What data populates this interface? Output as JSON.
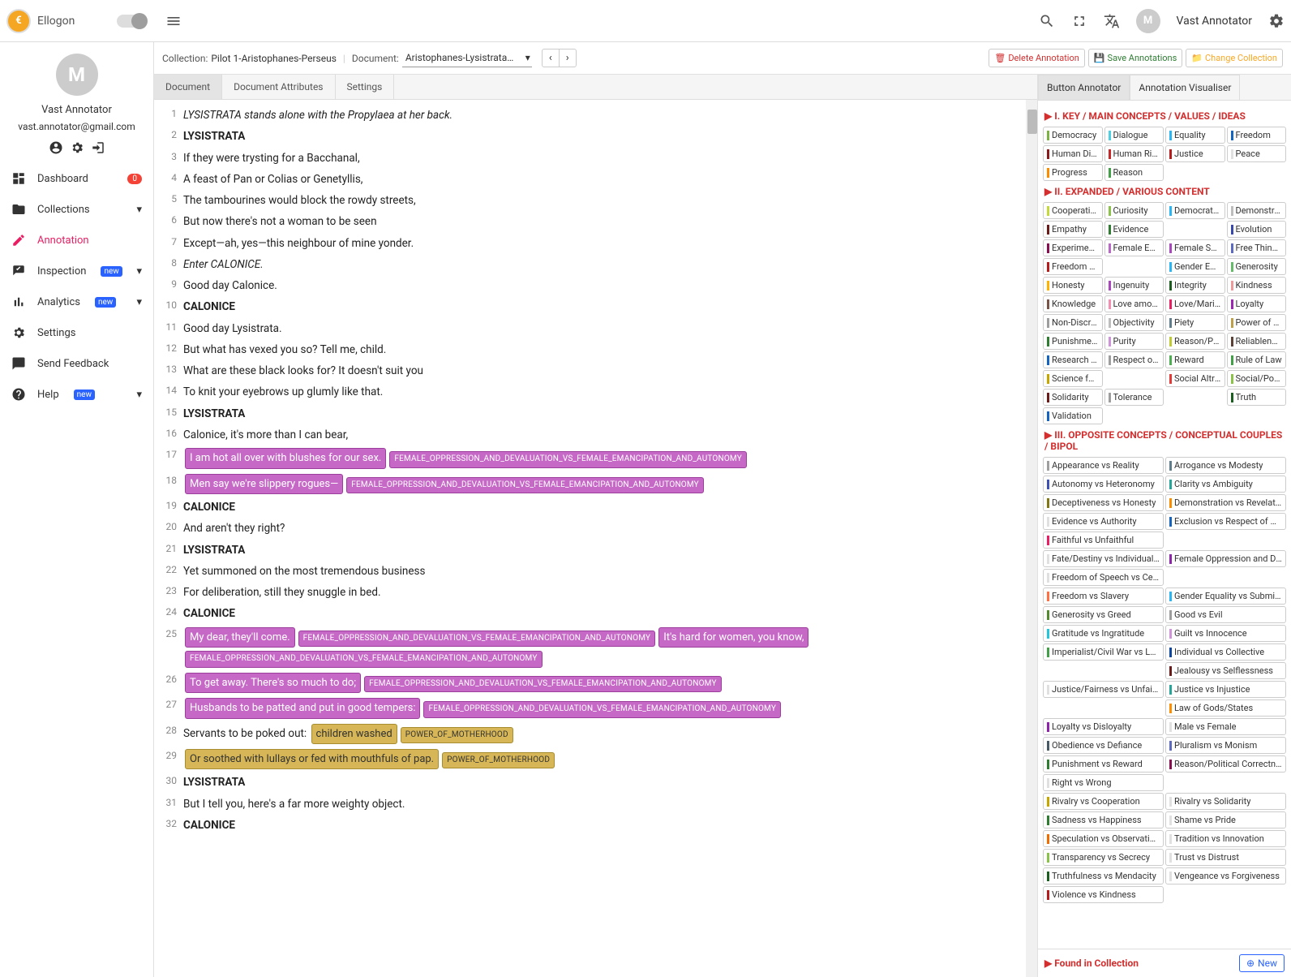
{
  "app": {
    "name": "Ellogon"
  },
  "user": {
    "name": "Vast Annotator",
    "email": "vast.annotator@gmail.com",
    "initial": "M"
  },
  "sidebar": {
    "items": [
      {
        "label": "Dashboard",
        "icon": "dashboard",
        "badge0": "0"
      },
      {
        "label": "Collections",
        "icon": "folder",
        "chev": true
      },
      {
        "label": "Annotation",
        "icon": "edit",
        "active": true
      },
      {
        "label": "Inspection",
        "icon": "inspect",
        "new": true,
        "chev": true
      },
      {
        "label": "Analytics",
        "icon": "analytics",
        "new": true,
        "chev": true
      },
      {
        "label": "Settings",
        "icon": "gear"
      },
      {
        "label": "Send Feedback",
        "icon": "feedback"
      },
      {
        "label": "Help",
        "icon": "help",
        "new": true,
        "chev": true
      }
    ],
    "newBadge": "new"
  },
  "breadcrumb": {
    "collectionLabel": "Collection:",
    "collectionValue": "Pilot 1-Aristophanes-Perseus",
    "documentLabel": "Document:",
    "documentValue": "Aristophanes-Lysistrata-Jac..."
  },
  "actions": {
    "delete": "Delete Annotation",
    "save": "Save Annotations",
    "change": "Change Collection"
  },
  "docTabs": [
    "Document",
    "Document Attributes",
    "Settings"
  ],
  "rpTabs": [
    "Button Annotator",
    "Annotation Visualiser"
  ],
  "lines": [
    {
      "n": 1,
      "t": "LYSISTRATA stands alone with the Propylaea at her back.",
      "cls": "italic"
    },
    {
      "n": 2,
      "t": "LYSISTRATA",
      "cls": "bold"
    },
    {
      "n": 3,
      "t": "If they were trysting for a Bacchanal,"
    },
    {
      "n": 4,
      "t": "A feast of Pan or Colias or Genetyllis,"
    },
    {
      "n": 5,
      "t": "The tambourines would block the rowdy streets,"
    },
    {
      "n": 6,
      "t": "But now there's not a woman to be seen"
    },
    {
      "n": 7,
      "t": "Except—ah, yes—this neighbour of mine yonder."
    },
    {
      "n": 8,
      "t": "Enter CALONICE.",
      "cls": "italic"
    },
    {
      "n": 9,
      "t": "Good day Calonice."
    },
    {
      "n": 10,
      "t": "CALONICE",
      "cls": "bold"
    },
    {
      "n": 11,
      "t": "Good day Lysistrata."
    },
    {
      "n": 12,
      "t": "But what has vexed you so? Tell me, child."
    },
    {
      "n": 13,
      "t": "What are these black looks for? It doesn't suit you"
    },
    {
      "n": 14,
      "t": "To knit your eyebrows up glumly like that."
    },
    {
      "n": 15,
      "t": "LYSISTRATA",
      "cls": "bold"
    },
    {
      "n": 16,
      "t": "Calonice, it's more than I can bear,"
    },
    {
      "n": 17,
      "hl": [
        {
          "t": "I am hot all over with blushes for our sex.",
          "c": "purple"
        },
        {
          "t": "FEMALE_OPPRESSION_AND_DEVALUATION_VS_FEMALE_EMANCIPATION_AND_AUTONOMY",
          "c": "purple",
          "mini": true
        }
      ]
    },
    {
      "n": 18,
      "hl": [
        {
          "t": "Men say we're slippery rogues—",
          "c": "purple"
        },
        {
          "t": "FEMALE_OPPRESSION_AND_DEVALUATION_VS_FEMALE_EMANCIPATION_AND_AUTONOMY",
          "c": "purple",
          "mini": true
        }
      ]
    },
    {
      "n": 19,
      "t": "CALONICE",
      "cls": "bold"
    },
    {
      "n": 20,
      "t": "And aren't they right?"
    },
    {
      "n": 21,
      "t": "LYSISTRATA",
      "cls": "bold"
    },
    {
      "n": 22,
      "t": "Yet summoned on the most tremendous business"
    },
    {
      "n": 23,
      "t": "For deliberation, still they snuggle in bed."
    },
    {
      "n": 24,
      "t": "CALONICE",
      "cls": "bold"
    },
    {
      "n": 25,
      "hl": [
        {
          "t": "My dear, they'll come.",
          "c": "purple"
        },
        {
          "t": "FEMALE_OPPRESSION_AND_DEVALUATION_VS_FEMALE_EMANCIPATION_AND_AUTONOMY",
          "c": "purple",
          "mini": true
        },
        {
          "t": "It's hard for women, you know,",
          "c": "purple"
        },
        {
          "t": "FEMALE_OPPRESSION_AND_DEVALUATION_VS_FEMALE_EMANCIPATION_AND_AUTONOMY",
          "c": "purple",
          "mini": true,
          "wrap": true
        }
      ]
    },
    {
      "n": 26,
      "hl": [
        {
          "t": "To get away. There's so much to do;",
          "c": "purple"
        },
        {
          "t": "FEMALE_OPPRESSION_AND_DEVALUATION_VS_FEMALE_EMANCIPATION_AND_AUTONOMY",
          "c": "purple",
          "mini": true
        }
      ]
    },
    {
      "n": 27,
      "hl": [
        {
          "t": "Husbands to be patted and put in good tempers:",
          "c": "purple"
        },
        {
          "t": "FEMALE_OPPRESSION_AND_DEVALUATION_VS_FEMALE_EMANCIPATION_AND_AUTONOMY",
          "c": "purple",
          "mini": true
        }
      ]
    },
    {
      "n": 28,
      "pre": "Servants to be poked out: ",
      "hl": [
        {
          "t": "children washed",
          "c": "ochre"
        },
        {
          "t": "POWER_OF_MOTHERHOOD",
          "c": "ochre",
          "mini": true
        }
      ]
    },
    {
      "n": 29,
      "hl": [
        {
          "t": "Or soothed with lullays or fed with mouthfuls of pap.",
          "c": "ochre"
        },
        {
          "t": "POWER_OF_MOTHERHOOD",
          "c": "ochre",
          "mini": true
        }
      ]
    },
    {
      "n": 30,
      "t": "LYSISTRATA",
      "cls": "bold"
    },
    {
      "n": 31,
      "t": "But I tell you, here's a far more weighty object."
    },
    {
      "n": 32,
      "t": "CALONICE",
      "cls": "bold"
    }
  ],
  "sections": {
    "s1": {
      "title": "I. KEY / MAIN CONCEPTS / VALUES / IDEAS",
      "tags": [
        {
          "l": "Democracy",
          "c": "#7cb342"
        },
        {
          "l": "Dialogue",
          "c": "#4dd0e1"
        },
        {
          "l": "Equality",
          "c": "#29b6f6"
        },
        {
          "l": "Freedom",
          "c": "#1565c0"
        },
        {
          "l": "Human Dignity",
          "c": "#8b1a1a"
        },
        {
          "l": "Human Rights",
          "c": "#c62828"
        },
        {
          "l": "Justice",
          "c": "#b71c1c"
        },
        {
          "l": "Peace",
          "c": "#e0e0e0"
        },
        {
          "l": "Progress",
          "c": "#fb8c00"
        },
        {
          "l": "Reason",
          "c": "#43a047"
        }
      ]
    },
    "s2": {
      "title": "II. EXPANDED / VARIOUS CONTENT",
      "tags": [
        {
          "l": "Cooperation",
          "c": "#c6d93b"
        },
        {
          "l": "Curiosity",
          "c": "#8bc34a"
        },
        {
          "l": "Democratic ... and Equality",
          "c": "#29b6f6"
        },
        {
          "l": "Demonstrab...",
          "c": "#bdbdbd"
        },
        {
          "l": "Empathy",
          "c": "#6a1b1a"
        },
        {
          "l": "Evidence",
          "c": "#2e7d32"
        },
        {
          "l": "",
          "c": "#fff",
          "skip": true
        },
        {
          "l": "Evolution",
          "c": "#3949ab"
        },
        {
          "l": "Experimenta...",
          "c": "#880e4f"
        },
        {
          "l": "Female Em... and Autonomy",
          "c": "#ba68c8"
        },
        {
          "l": "Female Spe...",
          "c": "#ab47bc"
        },
        {
          "l": "Free Thinking",
          "c": "#5c6bc0"
        },
        {
          "l": "Freedom of ...",
          "c": "#b71c1c"
        },
        {
          "l": "",
          "c": "#fff",
          "skip": true
        },
        {
          "l": "Gender Equ...",
          "c": "#29b6f6"
        },
        {
          "l": "Generosity",
          "c": "#66bb6a"
        },
        {
          "l": "Honesty",
          "c": "#ffb300"
        },
        {
          "l": "Ingenuity",
          "c": "#ab47bc"
        },
        {
          "l": "Integrity",
          "c": "#1b5e20"
        },
        {
          "l": "Kindness",
          "c": "#ef9a9a"
        },
        {
          "l": "Knowledge",
          "c": "#795548"
        },
        {
          "l": "Love among...",
          "c": "#f48fb1"
        },
        {
          "l": "Love/Marital ...",
          "c": "#e91e63"
        },
        {
          "l": "Loyalty",
          "c": "#9c27b0"
        },
        {
          "l": "Non-Discrim...",
          "c": "#9e9e9e"
        },
        {
          "l": "Objectivity",
          "c": "#bdbdbd"
        },
        {
          "l": "Piety",
          "c": "#607d8b"
        },
        {
          "l": "Power of Mot...",
          "c": "#bfa04a"
        },
        {
          "l": "Punishment",
          "c": "#2e7d32"
        },
        {
          "l": "Purity",
          "c": "#ce93d8"
        },
        {
          "l": "Reason/Poli...",
          "c": "#c0ca33"
        },
        {
          "l": "Reliableness",
          "c": "#5d4037"
        },
        {
          "l": "Research Fr...",
          "c": "#1565c0"
        },
        {
          "l": "Respect of ... Decisions",
          "c": "#9e9e9e"
        },
        {
          "l": "Reward",
          "c": "#4caf50"
        },
        {
          "l": "Rule of Law",
          "c": "#43a047"
        },
        {
          "l": "Science for ...",
          "c": "#c6a700"
        },
        {
          "l": "",
          "c": "#fff",
          "skip": true
        },
        {
          "l": "Social Altrui... Self-sacrifice",
          "c": "#e53935"
        },
        {
          "l": "Social/Politic...",
          "c": "#8bc34a"
        },
        {
          "l": "Solidarity",
          "c": "#6a1b1a"
        },
        {
          "l": "Tolerance",
          "c": "#9e9e9e"
        },
        {
          "l": "",
          "c": "#fff",
          "skip": true
        },
        {
          "l": "Truth",
          "c": "#1b5e20"
        },
        {
          "l": "Validation",
          "c": "#1565c0"
        }
      ]
    },
    "s3": {
      "title": "III. OPPOSITE CONCEPTS / CONCEPTUAL COUPLES / BIPOL",
      "tags": [
        {
          "l": "Appearance vs Reality",
          "c": "#9e9e9e"
        },
        {
          "l": "Arrogance vs Modesty",
          "c": "#607d8b"
        },
        {
          "l": "Autonomy vs Heteronomy",
          "c": "#3f51b5"
        },
        {
          "l": "Clarity vs Ambiguity",
          "c": "#26a69a"
        },
        {
          "l": "Deceptiveness vs Honesty",
          "c": "#827717"
        },
        {
          "l": "Demonstration vs Revelation",
          "c": "#fb8c00"
        },
        {
          "l": "Evidence vs Authority",
          "c": "#e0e0e0"
        },
        {
          "l": "Exclusion vs Respect of Minori... and Marginalised Communities",
          "c": "#1565c0"
        },
        {
          "l": "Faithful vs Unfaithful",
          "c": "#e91e63"
        },
        {
          "l": "",
          "c": "#fff",
          "skip": true
        },
        {
          "l": "Fate/Destiny vs Individual Law",
          "c": "#e0e0e0"
        },
        {
          "l": "Female Oppression and Deva... Female Emancipation and Auto...",
          "c": "#8e24aa"
        },
        {
          "l": "Freedom of Speech vs Censor...",
          "c": "#e0e0e0"
        },
        {
          "l": "",
          "c": "#fff",
          "skip": true
        },
        {
          "l": "Freedom vs Slavery",
          "c": "#ff7043"
        },
        {
          "l": "Gender Equality vs Submission",
          "c": "#29b6f6"
        },
        {
          "l": "Generosity vs Greed",
          "c": "#558b2f"
        },
        {
          "l": "Good vs Evil",
          "c": "#9e9e9e"
        },
        {
          "l": "Gratitude vs Ingratitude",
          "c": "#26c6da"
        },
        {
          "l": "Guilt vs Innocence",
          "c": "#ce93d8"
        },
        {
          "l": "Imperialist/Civil War vs Local and International Peace",
          "c": "#43a047"
        },
        {
          "l": "Individual vs Collective",
          "c": "#0d47a1"
        },
        {
          "l": "",
          "c": "#fff",
          "skip": true
        },
        {
          "l": "Jealousy vs Selflessness",
          "c": "#6a1b1a"
        },
        {
          "l": "Justice/Fairness vs Unfairness/Abuse of Power",
          "c": "#e0e0e0"
        },
        {
          "l": "Justice vs Injustice",
          "c": "#26a69a"
        },
        {
          "l": "",
          "c": "#fff",
          "skip": true
        },
        {
          "l": "Law of Gods/States",
          "c": "#ff8f00"
        },
        {
          "l": "Loyalty vs Disloyalty",
          "c": "#8e24aa"
        },
        {
          "l": "Male vs Female",
          "c": "#e0e0e0"
        },
        {
          "l": "Obedience vs Defiance",
          "c": "#455a64"
        },
        {
          "l": "Pluralism vs Monism",
          "c": "#5c6bc0"
        },
        {
          "l": "Punishment vs Reward",
          "c": "#2e7d32"
        },
        {
          "l": "Reason/Political Correctness vs Political Arbitrariness",
          "c": "#880e4f"
        },
        {
          "l": "Right vs Wrong",
          "c": "#e0e0e0"
        },
        {
          "l": "",
          "c": "#fff",
          "skip": true
        },
        {
          "l": "Rivalry vs Cooperation",
          "c": "#c6a700"
        },
        {
          "l": "Rivalry vs Solidarity",
          "c": "#e0e0e0"
        },
        {
          "l": "Sadness vs Happiness",
          "c": "#2e7d32"
        },
        {
          "l": "Shame vs Pride",
          "c": "#e0e0e0"
        },
        {
          "l": "Speculation vs Observation",
          "c": "#ef6c00"
        },
        {
          "l": "Tradition vs Innovation",
          "c": "#e0e0e0"
        },
        {
          "l": "Transparency vs Secrecy",
          "c": "#8bc34a"
        },
        {
          "l": "Trust vs Distrust",
          "c": "#e0e0e0"
        },
        {
          "l": "Truthfulness vs Mendacity",
          "c": "#1b5e20"
        },
        {
          "l": "Vengeance vs Forgiveness",
          "c": "#e0e0e0"
        },
        {
          "l": "Violence vs Kindness",
          "c": "#b71c1c"
        }
      ]
    }
  },
  "footer": {
    "found": "Found in Collection",
    "new": "New"
  }
}
